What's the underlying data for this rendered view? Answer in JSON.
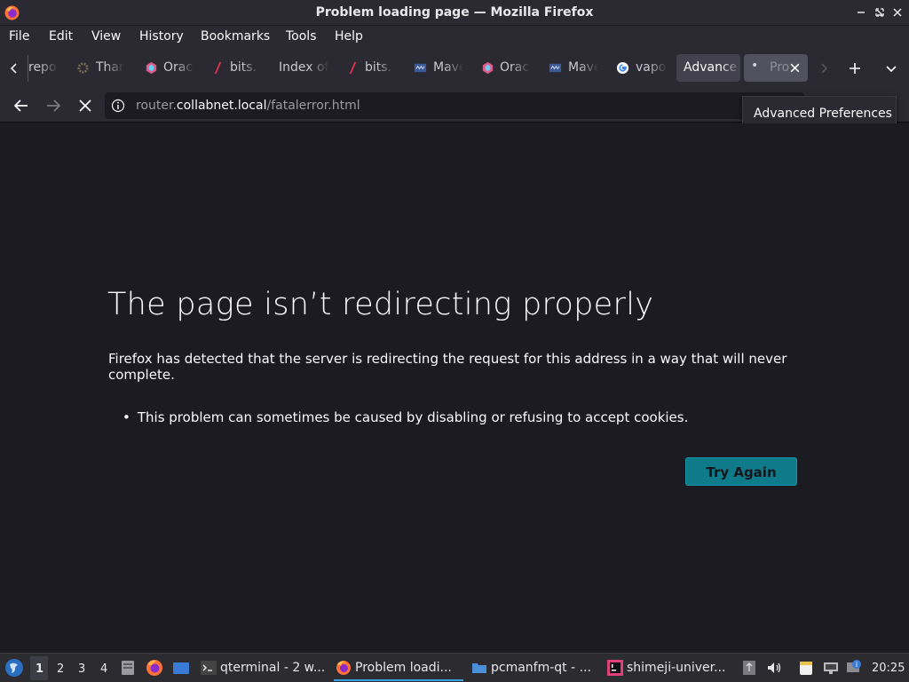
{
  "window": {
    "title": "Problem loading page — Mozilla Firefox"
  },
  "menu": [
    "File",
    "Edit",
    "View",
    "History",
    "Bookmarks",
    "Tools",
    "Help"
  ],
  "tabs": [
    {
      "label": "repo",
      "icon": "none"
    },
    {
      "label": "Thar",
      "icon": "gear-icon"
    },
    {
      "label": "Orac",
      "icon": "hexagon-icon"
    },
    {
      "label": "bits.",
      "icon": "slash-icon"
    },
    {
      "label": "Index of",
      "icon": "none"
    },
    {
      "label": "bits.",
      "icon": "slash-icon"
    },
    {
      "label": "Mave",
      "icon": "maven-icon"
    },
    {
      "label": "Orac",
      "icon": "hexagon-icon"
    },
    {
      "label": "Mave",
      "icon": "maven-icon"
    },
    {
      "label": "vapo",
      "icon": "google-icon"
    },
    {
      "label": "Advance",
      "icon": "none"
    },
    {
      "label": "Pro",
      "icon": "dot-icon"
    }
  ],
  "urlbar": {
    "prefix": "router.",
    "domain": "collabnet.local",
    "path": "/fatalerror.html"
  },
  "tooltip": "Advanced Preferences",
  "error": {
    "title": "The page isn’t redirecting properly",
    "description": "Firefox has detected that the server is redirecting the request for this address in a way that will never complete.",
    "bullet": "This problem can sometimes be caused by disabling or refusing to accept cookies.",
    "button": "Try Again"
  },
  "taskbar": {
    "desktops": [
      "1",
      "2",
      "3",
      "4"
    ],
    "tasks": [
      {
        "label": "qterminal - 2 w...",
        "icon": "terminal-icon"
      },
      {
        "label": "Problem loadi...",
        "icon": "firefox-icon"
      },
      {
        "label": "pcmanfm-qt - ...",
        "icon": "folder-icon"
      },
      {
        "label": "shimeji-univer...",
        "icon": "intellij-icon"
      }
    ],
    "clock": "20:25"
  },
  "colors": {
    "accent": "#0e7a8a",
    "chrome": "#2b2a33",
    "page_bg": "#1c1b22"
  }
}
